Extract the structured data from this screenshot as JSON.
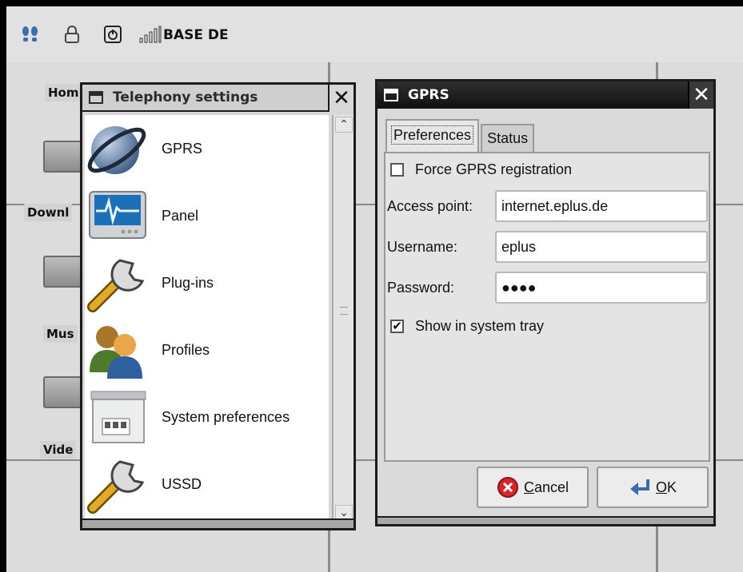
{
  "topbar": {
    "network_label": "BASE DE",
    "icons": [
      "footsteps-icon",
      "lock-icon",
      "power-icon",
      "signal-icon"
    ]
  },
  "desktop": {
    "labels": [
      "Hom",
      "Downl",
      "Mus",
      "Vide"
    ]
  },
  "telephony": {
    "title": "Telephony settings",
    "close_label": "✕",
    "items": [
      {
        "label": "GPRS",
        "icon": "globe-icon"
      },
      {
        "label": "Panel",
        "icon": "monitor-icon"
      },
      {
        "label": "Plug-ins",
        "icon": "wrench-icon"
      },
      {
        "label": "Profiles",
        "icon": "users-icon"
      },
      {
        "label": "System preferences",
        "icon": "control-panel-icon"
      },
      {
        "label": "USSD",
        "icon": "wrench-icon"
      }
    ]
  },
  "gprs": {
    "title": "GPRS",
    "close_label": "✕",
    "tabs": [
      "Preferences",
      "Status"
    ],
    "active_tab": "Preferences",
    "force_registration": {
      "label": "Force GPRS registration",
      "checked": false
    },
    "access_point": {
      "label": "Access point:",
      "value": "internet.eplus.de"
    },
    "username": {
      "label": "Username:",
      "value": "eplus"
    },
    "password": {
      "label": "Password:",
      "value": "●●●●"
    },
    "show_tray": {
      "label": "Show in system tray",
      "checked": true,
      "mark": "✔"
    },
    "cancel_prefix": "C",
    "cancel_rest": "ancel",
    "ok_prefix": "O",
    "ok_rest": "K"
  }
}
